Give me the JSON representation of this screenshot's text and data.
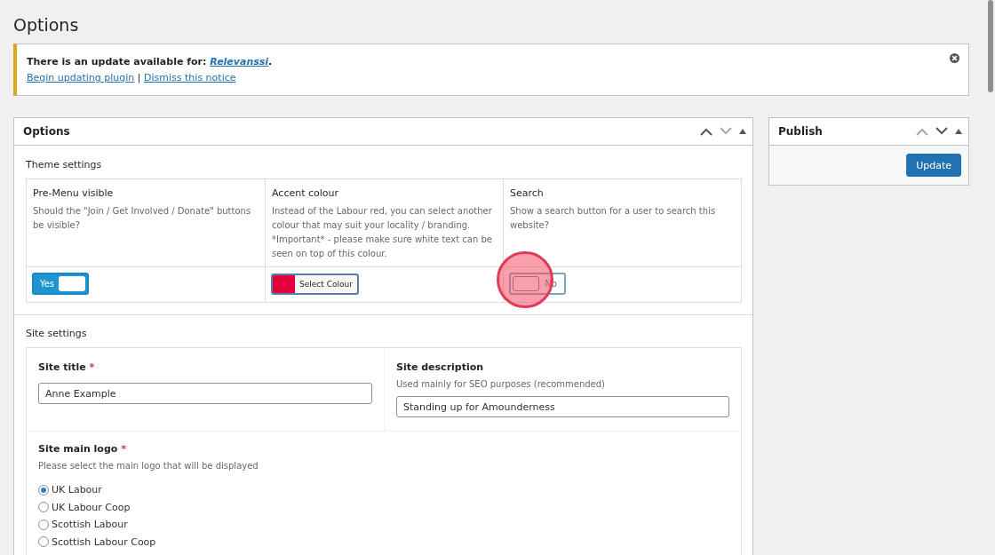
{
  "page_title": "Options",
  "notice": {
    "text": "There is an update available for: ",
    "plugin": "Relevanssi",
    "after": ".",
    "links": [
      "Begin updating plugin",
      "Dismiss this notice"
    ],
    "separator": "|"
  },
  "options_box": {
    "title": "Options",
    "arrows": [
      {
        "kind": "up",
        "disabled": false
      },
      {
        "kind": "down",
        "disabled": true
      }
    ],
    "theme_section": "Theme settings",
    "theme_settings": [
      {
        "kind": "toggle",
        "title": "Pre-Menu visible",
        "description": "Should the \"Join / Get Involved / Donate\" buttons be visible?",
        "toggle": {
          "label": "Yes",
          "on": true
        }
      },
      {
        "kind": "colour",
        "title": "Accent colour",
        "description": "Instead of the Labour red, you can select another colour that may suit your locality / branding. *Important* - please make sure white text can be seen on top of this colour.",
        "button": "Select Colour",
        "color": "#e4003b"
      },
      {
        "kind": "toggle",
        "title": "Search",
        "description": "Show a search button for a user to search this website?",
        "toggle": {
          "label": "No",
          "on": false
        },
        "highlighted": true
      }
    ],
    "site_section": "Site settings",
    "site_title": {
      "label": "Site title",
      "required_mark": "*",
      "value": "Anne Example"
    },
    "site_description": {
      "label": "Site description",
      "hint": "Used mainly for SEO purposes (recommended)",
      "value": "Standing up for Amounderness"
    },
    "main_logo": {
      "label": "Site main logo",
      "required_mark": "*",
      "hint": "Please select the main logo that will be displayed",
      "options": [
        {
          "label": "UK Labour",
          "selected": true
        },
        {
          "label": "UK Labour Coop",
          "selected": false
        },
        {
          "label": "Scottish Labour",
          "selected": false
        },
        {
          "label": "Scottish Labour Coop",
          "selected": false
        }
      ]
    }
  },
  "publish_box": {
    "title": "Publish",
    "arrows": [
      {
        "kind": "up",
        "disabled": true
      },
      {
        "kind": "down",
        "disabled": false
      }
    ],
    "button": "Update"
  }
}
